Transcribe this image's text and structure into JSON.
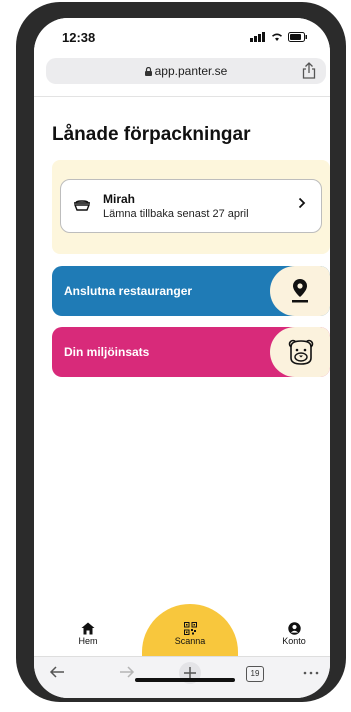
{
  "status_bar": {
    "time": "12:38"
  },
  "browser": {
    "url": "app.panter.se",
    "tab_count": "19"
  },
  "page": {
    "title": "Lånade förpackningar"
  },
  "loan": {
    "name": "Mirah",
    "return_text": "Lämna tillbaka senast 27 april"
  },
  "actions": {
    "restaurants_label": "Anslutna restauranger",
    "environment_label": "Din miljöinsats"
  },
  "nav": {
    "home": "Hem",
    "scan": "Scanna",
    "account": "Konto"
  },
  "colors": {
    "restaurants": "#1f7bb6",
    "environment": "#d82a7a",
    "scan": "#f8c73d",
    "cream": "#fdf6dc"
  }
}
